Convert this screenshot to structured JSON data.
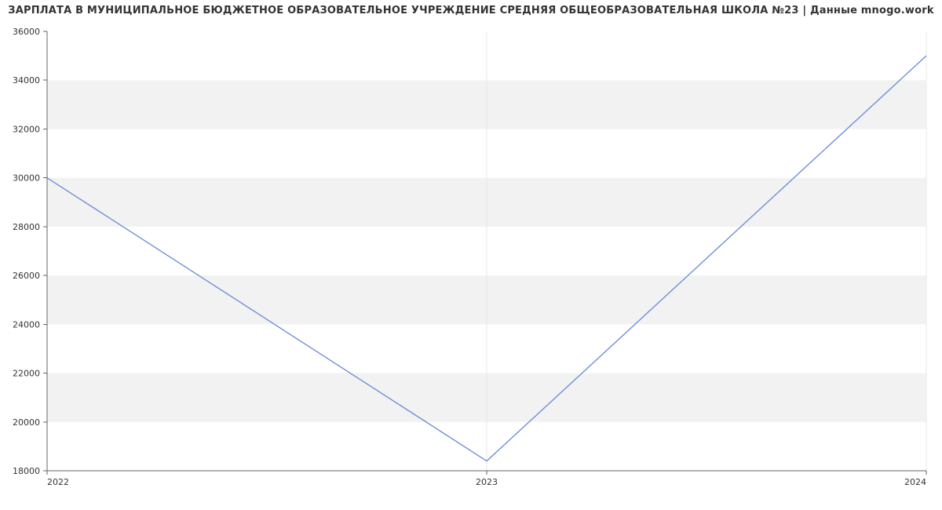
{
  "title": "ЗАРПЛАТА В МУНИЦИПАЛЬНОЕ БЮДЖЕТНОЕ ОБРАЗОВАТЕЛЬНОЕ УЧРЕЖДЕНИЕ СРЕДНЯЯ ОБЩЕОБРАЗОВАТЕЛЬНАЯ ШКОЛА №23 | Данные mnogo.work",
  "chart_data": {
    "type": "line",
    "title": "ЗАРПЛАТА В МУНИЦИПАЛЬНОЕ БЮДЖЕТНОЕ ОБРАЗОВАТЕЛЬНОЕ УЧРЕЖДЕНИЕ СРЕДНЯЯ ОБЩЕОБРАЗОВАТЕЛЬНАЯ ШКОЛА №23 | Данные mnogo.work",
    "xlabel": "",
    "ylabel": "",
    "x": [
      2022,
      2023,
      2024
    ],
    "y": [
      30000,
      18400,
      35000
    ],
    "x_ticks": [
      2022,
      2023,
      2024
    ],
    "y_ticks": [
      18000,
      20000,
      22000,
      24000,
      26000,
      28000,
      30000,
      32000,
      34000,
      36000
    ],
    "xlim": [
      2022,
      2024
    ],
    "ylim": [
      18000,
      36000
    ],
    "grid_bands": true,
    "line_color": "#6f8fd8"
  }
}
